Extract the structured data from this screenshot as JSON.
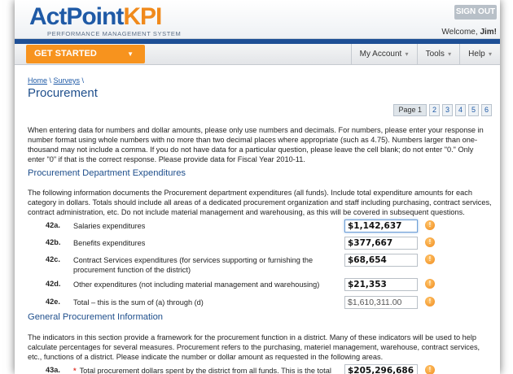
{
  "header": {
    "logo_act": "ActPoint",
    "logo_kpi": "KPI",
    "logo_tagline": "PERFORMANCE MANAGEMENT SYSTEM",
    "signout_label": "SIGN OUT",
    "welcome_prefix": "Welcome, ",
    "welcome_user": "Jim!"
  },
  "nav": {
    "get_started": "GET STARTED",
    "items": [
      "My Account",
      "Tools",
      "Help"
    ]
  },
  "breadcrumb": {
    "home": "Home",
    "surveys": "Surveys"
  },
  "page_title": "Procurement",
  "pager": {
    "current": "Page 1",
    "pages": [
      "2",
      "3",
      "4",
      "5",
      "6"
    ]
  },
  "intro": "When entering data for numbers and dollar amounts, please only use numbers and decimals. For numbers, please enter your response in number format using whole numbers with no more than two decimal places where appropriate (such as 4.75). Numbers larger than one-thousand may not include a comma. If you do not have data for a particular question, please leave the cell blank; do not enter \"0.\" Only enter \"0\" if that is the correct response. Please provide data for Fiscal Year 2010-11.",
  "section1": {
    "title": "Procurement Department Expenditures",
    "description": "The following information documents the Procurement department expenditures (all funds). Include total expenditure amounts for each category in dollars. Totals should include all areas of a dedicated procurement organization and staff including purchasing, contract services, contract administration, etc. Do not include material management and warehousing, as this will be covered in subsequent questions.",
    "rows": [
      {
        "num": "42a.",
        "label": "Salaries expenditures",
        "value": "$1,142,637"
      },
      {
        "num": "42b.",
        "label": "Benefits expenditures",
        "value": "$377,667"
      },
      {
        "num": "42c.",
        "label": "Contract Services expenditures (for services supporting or furnishing the procurement function of the district)",
        "value": "$68,654"
      },
      {
        "num": "42d.",
        "label": "Other expenditures (not including material management and warehousing)",
        "value": "$21,353"
      },
      {
        "num": "42e.",
        "label": "Total – this is the sum of (a) through (d)",
        "value": "$1,610,311.00"
      }
    ]
  },
  "section2": {
    "title": "General Procurement Information",
    "description": "The indicators in this section provide a framework for the procurement function in a district. Many of these indicators will be used to help calculate percentages for several measures. Procurement refers to the purchasing, materiel management, warehouse, contract services, etc., functions of a district. Please indicate the number or dollar amount as requested in the following areas.",
    "row": {
      "num": "43a.",
      "star": "*",
      "label": "Total procurement dollars spent by the district from all funds. This is the total dollar",
      "value": "$205,296,686"
    }
  },
  "info_icon_glyph": "!"
}
